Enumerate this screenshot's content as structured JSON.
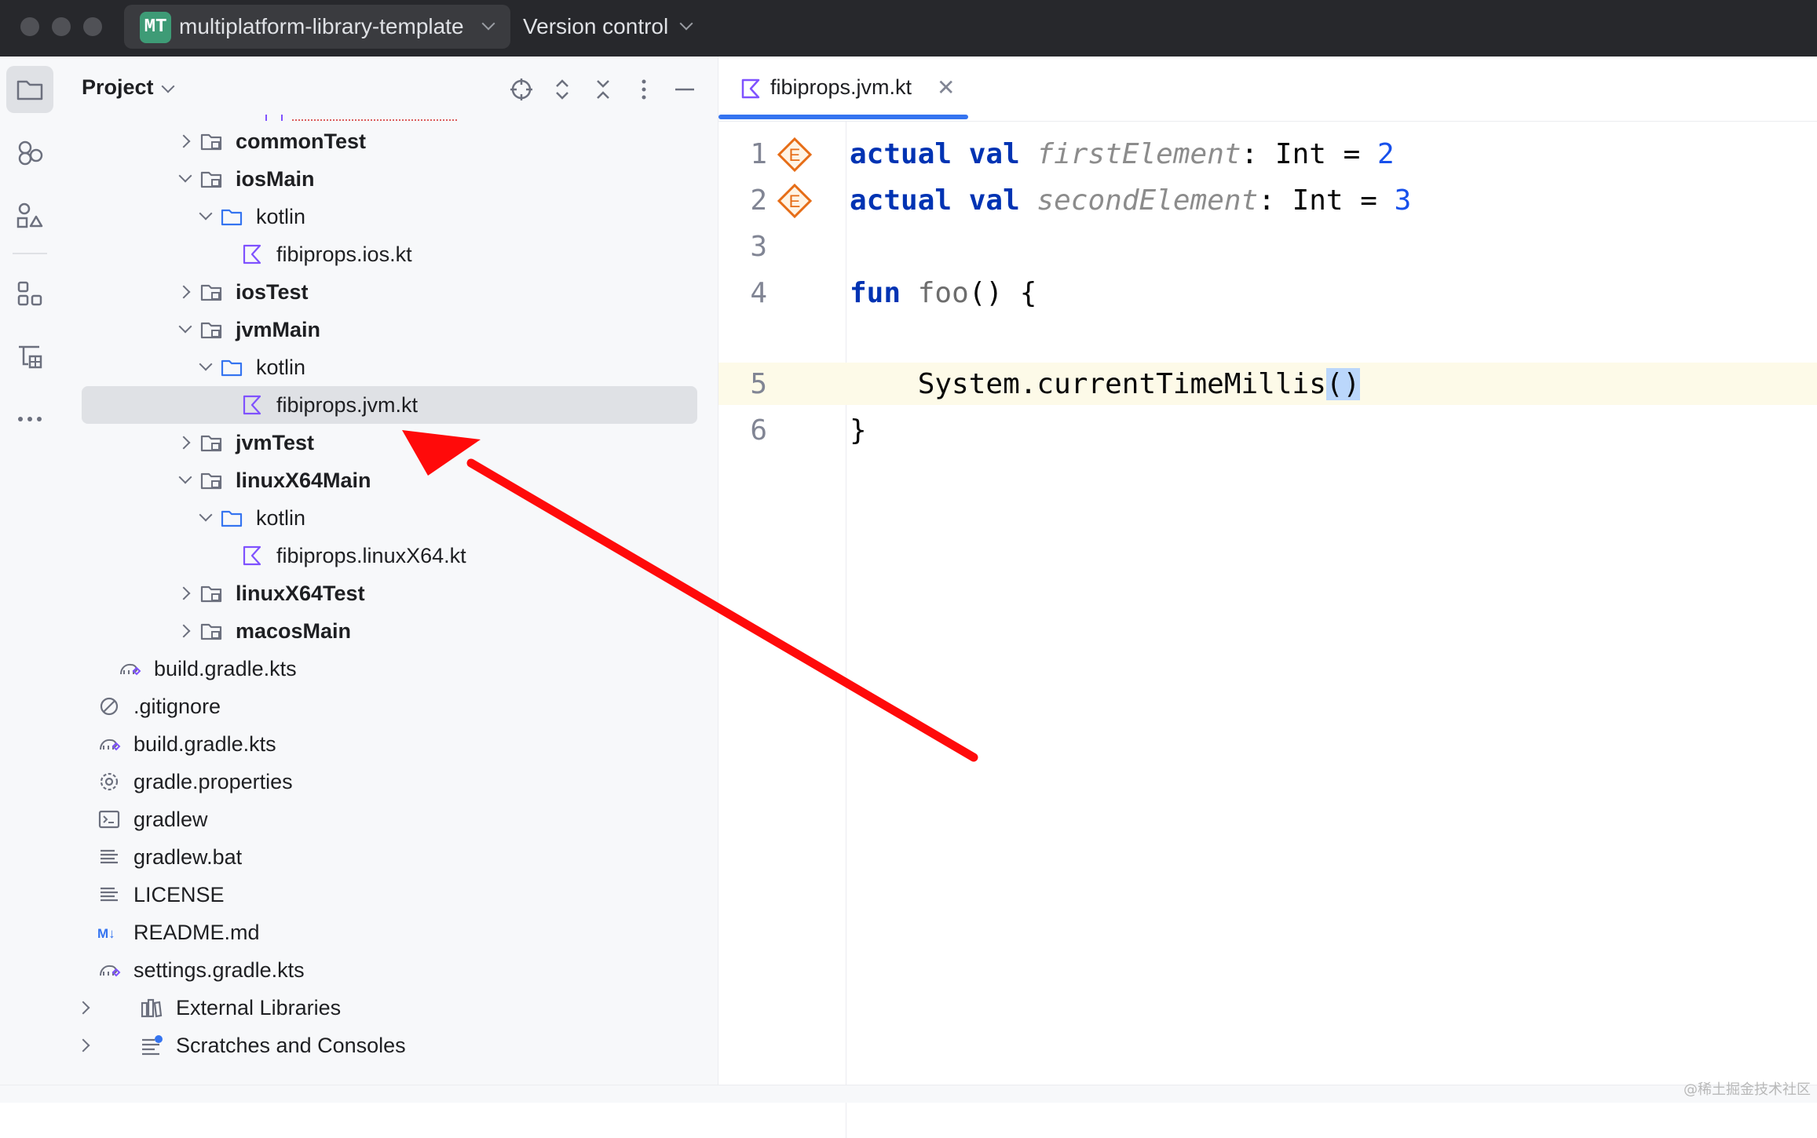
{
  "window": {
    "project_badge": "MT",
    "project_name": "multiplatform-library-template",
    "vcs_label": "Version control"
  },
  "project_panel": {
    "title": "Project",
    "tree": [
      {
        "label": "commonTest",
        "type": "module-folder",
        "state": "collapsed",
        "bold": true
      },
      {
        "label": "iosMain",
        "type": "module-folder",
        "state": "expanded",
        "bold": true
      },
      {
        "label": "kotlin",
        "type": "folder",
        "state": "expanded",
        "bold": false
      },
      {
        "label": "fibiprops.ios.kt",
        "type": "kotlin-file",
        "bold": false
      },
      {
        "label": "iosTest",
        "type": "module-folder",
        "state": "collapsed",
        "bold": true
      },
      {
        "label": "jvmMain",
        "type": "module-folder",
        "state": "expanded",
        "bold": true
      },
      {
        "label": "kotlin",
        "type": "folder",
        "state": "expanded",
        "bold": false
      },
      {
        "label": "fibiprops.jvm.kt",
        "type": "kotlin-file",
        "bold": false,
        "selected": true
      },
      {
        "label": "jvmTest",
        "type": "module-folder",
        "state": "collapsed",
        "bold": true
      },
      {
        "label": "linuxX64Main",
        "type": "module-folder",
        "state": "expanded",
        "bold": true
      },
      {
        "label": "kotlin",
        "type": "folder",
        "state": "expanded",
        "bold": false
      },
      {
        "label": "fibiprops.linuxX64.kt",
        "type": "kotlin-file",
        "bold": false
      },
      {
        "label": "linuxX64Test",
        "type": "module-folder",
        "state": "collapsed",
        "bold": true
      },
      {
        "label": "macosMain",
        "type": "module-folder",
        "state": "collapsed",
        "bold": true
      },
      {
        "label": "build.gradle.kts",
        "type": "gradle-file",
        "bold": false
      },
      {
        "label": ".gitignore",
        "type": "ignore-file",
        "bold": false
      },
      {
        "label": "build.gradle.kts",
        "type": "gradle-file",
        "bold": false
      },
      {
        "label": "gradle.properties",
        "type": "settings-file",
        "bold": false
      },
      {
        "label": "gradlew",
        "type": "shell-file",
        "bold": false
      },
      {
        "label": "gradlew.bat",
        "type": "text-file",
        "bold": false
      },
      {
        "label": "LICENSE",
        "type": "text-file",
        "bold": false
      },
      {
        "label": "README.md",
        "type": "markdown-file",
        "bold": false
      },
      {
        "label": "settings.gradle.kts",
        "type": "gradle-file",
        "bold": false
      },
      {
        "label": "External Libraries",
        "type": "libraries",
        "state": "collapsed",
        "bold": false
      },
      {
        "label": "Scratches and Consoles",
        "type": "scratches",
        "state": "collapsed",
        "bold": false
      }
    ]
  },
  "editor": {
    "tab_label": "fibiprops.jvm.kt",
    "gutter_marker": "E",
    "lines": [
      {
        "number": "1"
      },
      {
        "number": "2"
      },
      {
        "number": "3"
      },
      {
        "number": "4"
      },
      {
        "number": "5"
      },
      {
        "number": "6"
      }
    ],
    "tokens": {
      "l1_actual": "actual",
      "l1_val": "val",
      "l1_name": "firstElement",
      "l1_colon": ": ",
      "l1_type": "Int",
      "l1_eq": " = ",
      "l1_num": "2",
      "l2_actual": "actual",
      "l2_val": "val",
      "l2_name": "secondElement",
      "l2_colon": ": ",
      "l2_type": "Int",
      "l2_eq": " = ",
      "l2_num": "3",
      "l4_fun": "fun",
      "l4_name": "foo",
      "l4_rest": "() {",
      "l5_call": "System.currentTimeMillis",
      "l5_parens": "()",
      "l6_close": "}"
    }
  },
  "watermark": "@稀土掘金技术社区",
  "colors": {
    "titlebar": "#27282c",
    "panel": "#f7f8fa",
    "selection": "#dfe1e5",
    "keyword": "#0033b3",
    "number": "#1750eb",
    "annotation_arrow": "#ff0000",
    "tab_underline": "#3574f0"
  }
}
